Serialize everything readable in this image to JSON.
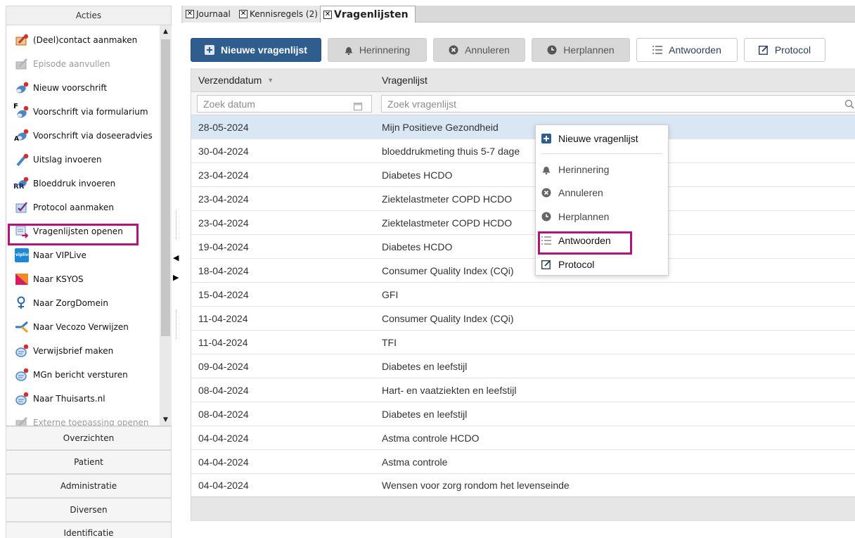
{
  "left_panel": {
    "header": "Acties",
    "actions": [
      {
        "label": "(Deel)contact aanmaken"
      },
      {
        "label": "Episode aanvullen"
      },
      {
        "label": "Nieuw voorschrift"
      },
      {
        "label": "Voorschrift via formularium"
      },
      {
        "label": "Voorschrift via doseeradvies"
      },
      {
        "label": "Uitslag invoeren"
      },
      {
        "label": "Bloeddruk invoeren"
      },
      {
        "label": "Protocol aanmaken"
      },
      {
        "label": "Vragenlijsten openen"
      },
      {
        "label": "Naar VIPLive"
      },
      {
        "label": "Naar KSYOS"
      },
      {
        "label": "Naar ZorgDomein"
      },
      {
        "label": "Naar Vecozo Verwijzen"
      },
      {
        "label": "Verwijsbrief maken"
      },
      {
        "label": "MGn bericht versturen"
      },
      {
        "label": "Naar Thuisarts.nl"
      },
      {
        "label": "Externe toepassing openen"
      }
    ],
    "sections": [
      "Overzichten",
      "Patient",
      "Administratie",
      "Diversen",
      "Identificatie"
    ],
    "viplive_badge": "viplive",
    "rr_badge": "RR",
    "f_badge": "F",
    "a_badge": "A"
  },
  "tabs": [
    {
      "label": "Journaal"
    },
    {
      "label": "Kennisregels (2)"
    },
    {
      "label": "Vragenlijsten"
    }
  ],
  "toolbar": {
    "new_label": "Nieuwe vragenlijst",
    "reminder_label": "Herinnering",
    "cancel_label": "Annuleren",
    "reschedule_label": "Herplannen",
    "answers_label": "Antwoorden",
    "protocol_label": "Protocol"
  },
  "grid": {
    "col_date": "Verzenddatum",
    "col_list": "Vragenlijst",
    "search_date_placeholder": "Zoek datum",
    "search_list_placeholder": "Zoek vragenlijst",
    "rows": [
      {
        "date": "28-05-2024",
        "name": "Mijn Positieve Gezondheid"
      },
      {
        "date": "30-04-2024",
        "name": "bloeddrukmeting thuis 5-7 dage"
      },
      {
        "date": "23-04-2024",
        "name": "Diabetes HCDO"
      },
      {
        "date": "23-04-2024",
        "name": "Ziektelastmeter COPD HCDO"
      },
      {
        "date": "23-04-2024",
        "name": "Ziektelastmeter COPD HCDO"
      },
      {
        "date": "19-04-2024",
        "name": "Diabetes HCDO"
      },
      {
        "date": "18-04-2024",
        "name": "Consumer Quality Index (CQi)"
      },
      {
        "date": "15-04-2024",
        "name": "GFI"
      },
      {
        "date": "11-04-2024",
        "name": "Consumer Quality Index (CQi)"
      },
      {
        "date": "11-04-2024",
        "name": "TFI"
      },
      {
        "date": "09-04-2024",
        "name": "Diabetes en leefstijl"
      },
      {
        "date": "08-04-2024",
        "name": "Hart- en vaatziekten en leefstijl"
      },
      {
        "date": "08-04-2024",
        "name": "Diabetes en leefstijl"
      },
      {
        "date": "04-04-2024",
        "name": "Astma controle HCDO"
      },
      {
        "date": "04-04-2024",
        "name": "Astma controle"
      },
      {
        "date": "04-04-2024",
        "name": "Wensen voor zorg rondom het levenseinde"
      }
    ]
  },
  "context_menu": {
    "new_label": "Nieuwe vragenlijst",
    "reminder_label": "Herinnering",
    "cancel_label": "Annuleren",
    "reschedule_label": "Herplannen",
    "answers_label": "Antwoorden",
    "protocol_label": "Protocol"
  },
  "colors": {
    "primary": "#2e5d8e",
    "selection": "#d9e6f3",
    "highlight": "#b0157d"
  }
}
